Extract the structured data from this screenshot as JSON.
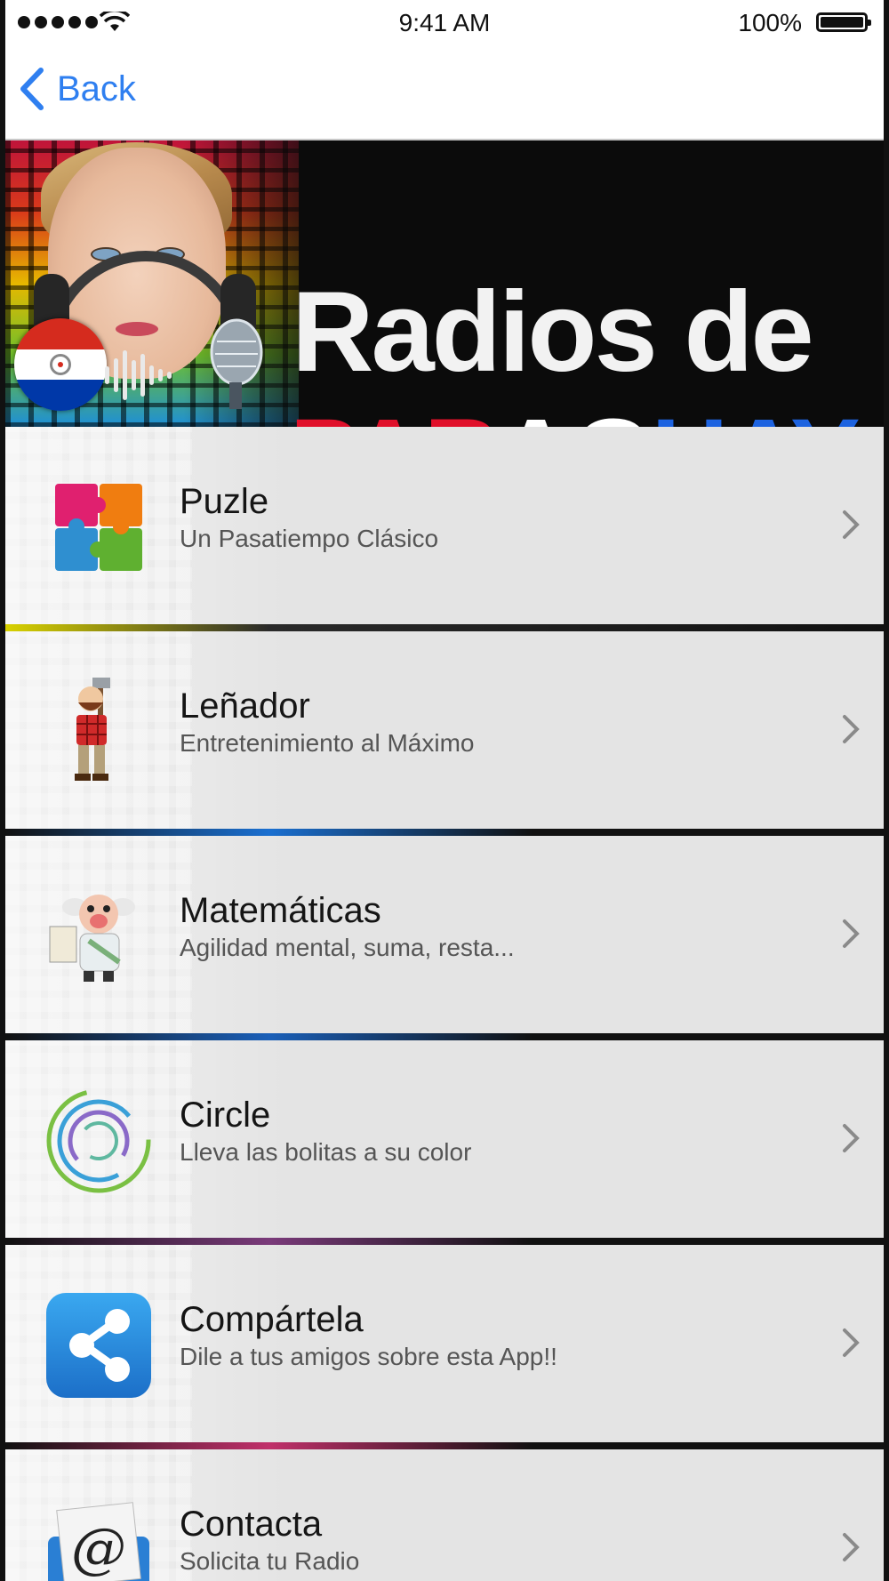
{
  "status_bar": {
    "time": "9:41 AM",
    "battery_percent": "100%",
    "signal_bars": 5
  },
  "nav": {
    "back_label": "Back"
  },
  "banner": {
    "title_line1": "Radios de",
    "title_line2_part1": "PAR",
    "title_line2_part2": "AG",
    "title_line2_part3": "UAY"
  },
  "menu": [
    {
      "label": "Puzle",
      "subtitle": "Un Pasatiempo Clásico",
      "icon": "puzzle-icon"
    },
    {
      "label": "Leñador",
      "subtitle": "Entretenimiento al Máximo",
      "icon": "lumberjack-icon"
    },
    {
      "label": "Matemáticas",
      "subtitle": "Agilidad mental, suma, resta...",
      "icon": "math-professor-icon"
    },
    {
      "label": "Circle",
      "subtitle": "Lleva las bolitas a su color",
      "icon": "circle-game-icon"
    },
    {
      "label": "Compártela",
      "subtitle": "Dile a tus amigos sobre esta App!!",
      "icon": "share-icon"
    },
    {
      "label": "Contacta",
      "subtitle": "Solicita tu Radio",
      "icon": "email-icon"
    }
  ],
  "colors": {
    "accent_blue": "#2f7ff0",
    "flag_red": "#d52b1e",
    "flag_blue": "#0038a8",
    "title_red": "#e0102a",
    "title_blue": "#1d63e0"
  }
}
